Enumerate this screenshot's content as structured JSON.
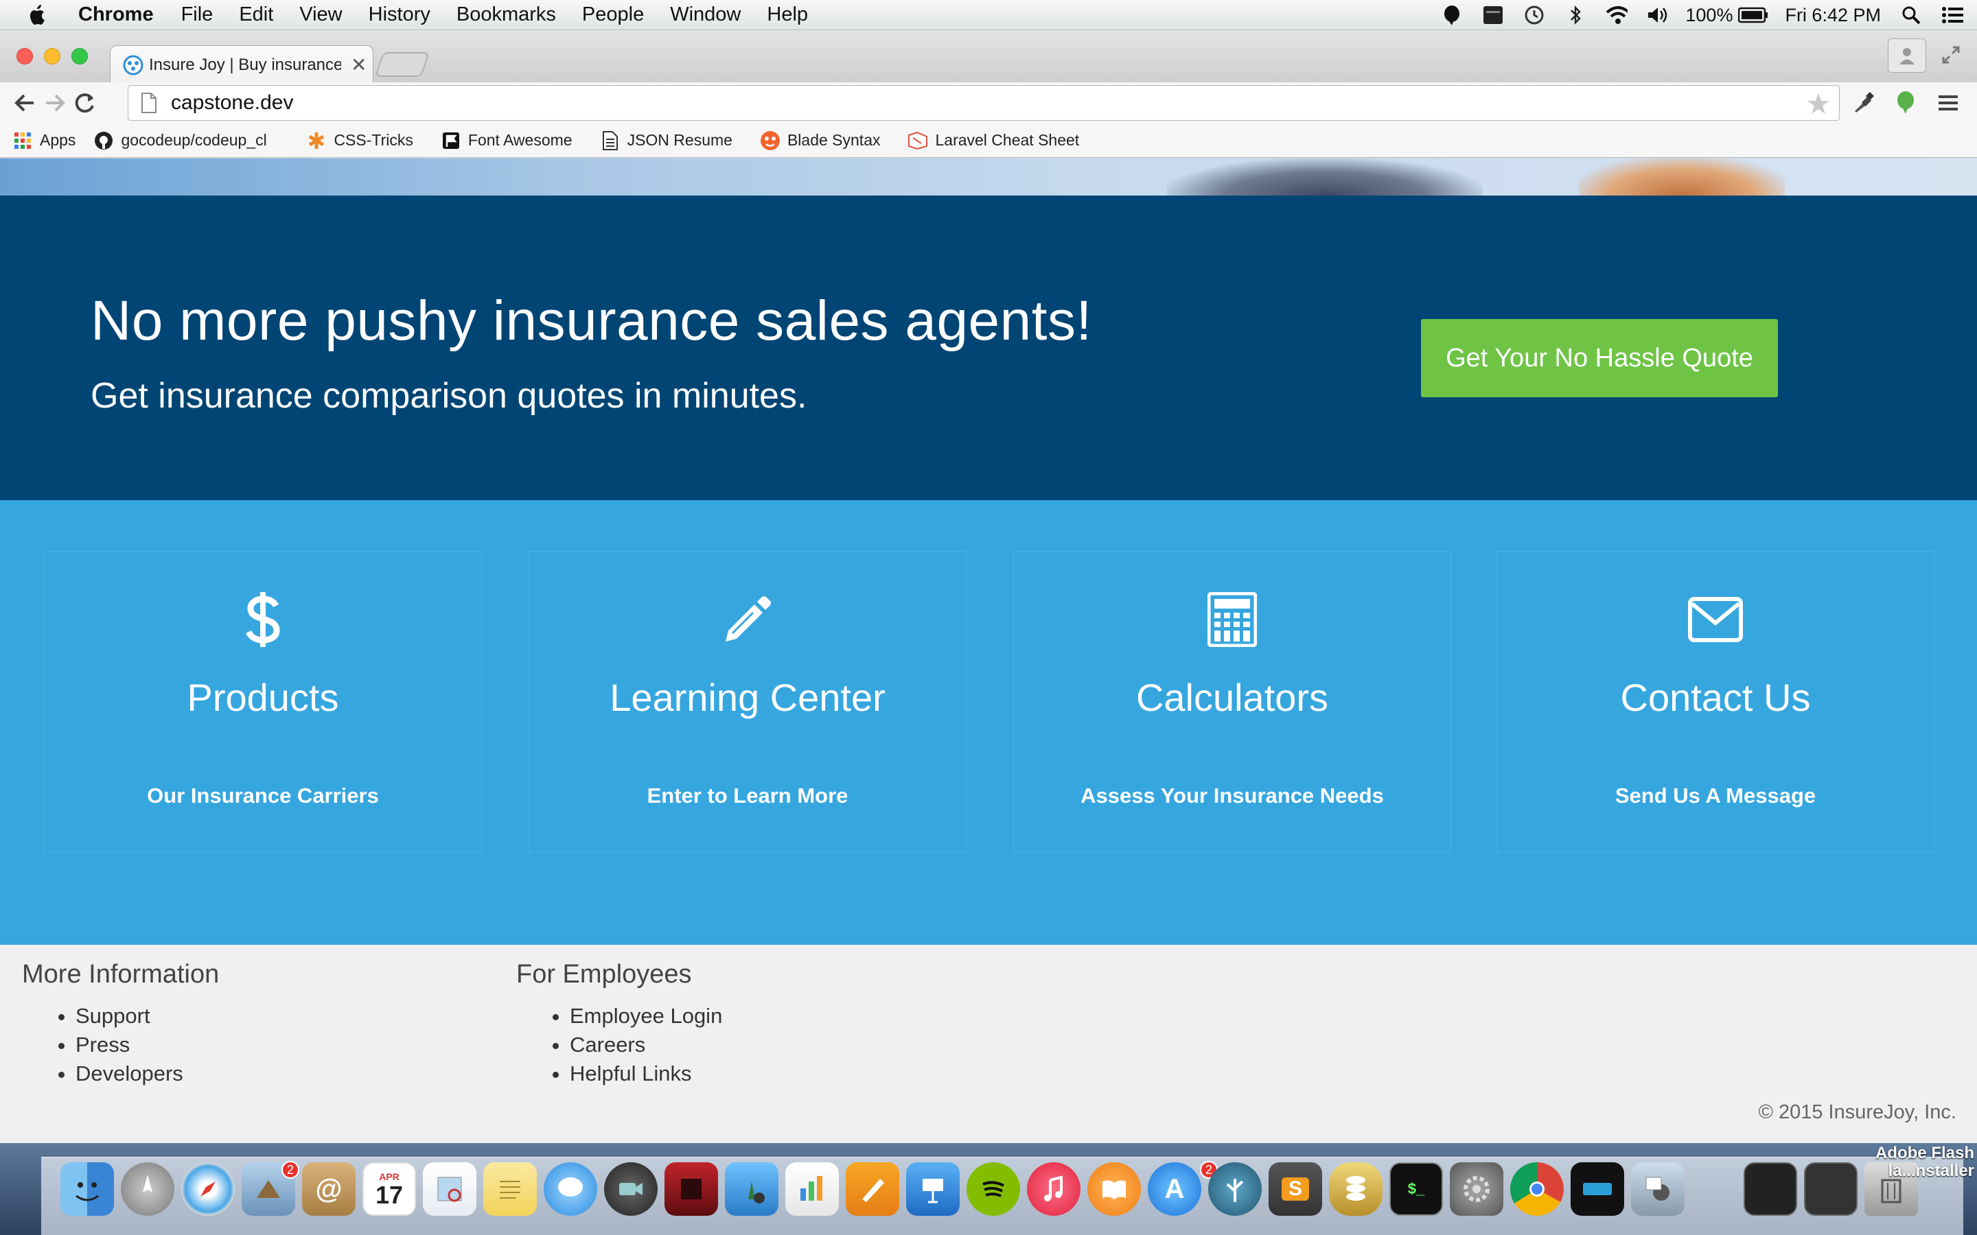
{
  "menubar": {
    "app_name": "Chrome",
    "items": [
      "File",
      "Edit",
      "View",
      "History",
      "Bookmarks",
      "People",
      "Window",
      "Help"
    ],
    "battery": "100%",
    "clock": "Fri 6:42 PM"
  },
  "browser": {
    "tab_title": "Insure Joy | Buy insurance w",
    "url": "capstone.dev",
    "bookmarks": [
      "Apps",
      "gocodeup/codeup_cl",
      "CSS-Tricks",
      "Font Awesome",
      "JSON Resume",
      "Blade Syntax",
      "Laravel Cheat Sheet"
    ]
  },
  "banner": {
    "headline": "No more pushy insurance sales agents!",
    "subheadline": "Get insurance comparison quotes in minutes.",
    "cta_label": "Get Your No Hassle Quote"
  },
  "features": [
    {
      "icon": "dollar-icon",
      "title": "Products",
      "link": "Our Insurance Carriers"
    },
    {
      "icon": "pencil-icon",
      "title": "Learning Center",
      "link": "Enter to Learn More"
    },
    {
      "icon": "calculator-icon",
      "title": "Calculators",
      "link": "Assess Your Insurance Needs"
    },
    {
      "icon": "envelope-icon",
      "title": "Contact Us",
      "link": "Send Us A Message"
    }
  ],
  "footer": {
    "more_info": {
      "heading": "More Information",
      "links": [
        "Support",
        "Press",
        "Developers"
      ]
    },
    "employees": {
      "heading": "For Employees",
      "links": [
        "Employee Login",
        "Careers",
        "Helpful Links"
      ]
    },
    "copyright": "© 2015 InsureJoy, Inc."
  },
  "dock": {
    "calendar_month": "APR",
    "calendar_day": "17",
    "badges": [
      "2",
      "2"
    ],
    "notification_label_line1": "Adobe Flash",
    "notification_label_line2": "la...nstaller"
  },
  "colors": {
    "banner_bg": "#004574",
    "features_bg": "#36a6df",
    "cta_bg": "#6fc446",
    "footer_bg": "#f0f0f0"
  }
}
